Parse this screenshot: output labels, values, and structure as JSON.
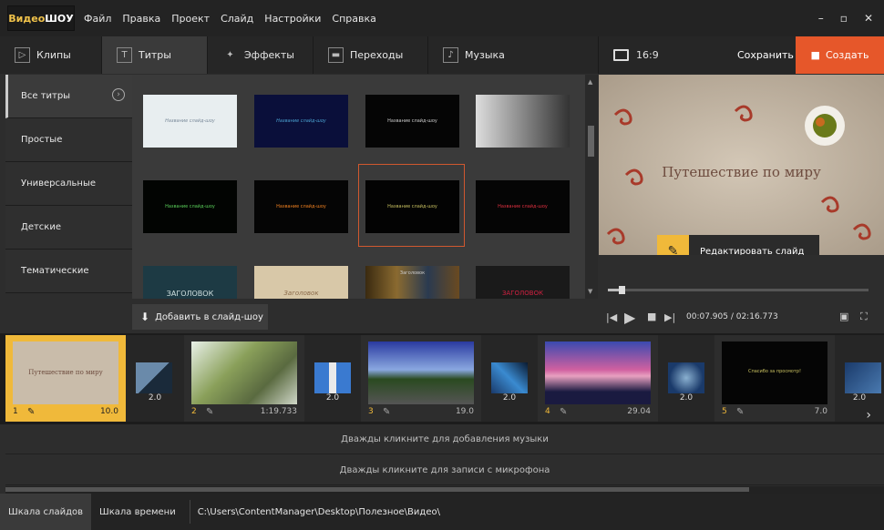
{
  "titlebar": {
    "logo_a": "Видео",
    "logo_b": "ШОУ",
    "menu": [
      "Файл",
      "Правка",
      "Проект",
      "Слайд",
      "Настройки",
      "Справка"
    ],
    "minimize": "–",
    "maximize": "▫",
    "close": "✕"
  },
  "tabs": [
    {
      "label": "Клипы",
      "icon": "clips-icon"
    },
    {
      "label": "Титры",
      "icon": "titles-icon"
    },
    {
      "label": "Эффекты",
      "icon": "effects-icon"
    },
    {
      "label": "Переходы",
      "icon": "transitions-icon"
    },
    {
      "label": "Музыка",
      "icon": "music-icon"
    }
  ],
  "header": {
    "ratio": "16:9",
    "save_label": "Сохранить",
    "create_label": "Создать"
  },
  "sidebar": {
    "items": [
      {
        "label": "Все титры"
      },
      {
        "label": "Простые"
      },
      {
        "label": "Универсальные"
      },
      {
        "label": "Детские"
      },
      {
        "label": "Тематические"
      }
    ]
  },
  "gallery": {
    "thumbs": [
      {
        "text": "Название слайд-шоу"
      },
      {
        "text": "Название слайд-шоу"
      },
      {
        "text": "Название слайд-шоу"
      },
      {
        "text": ""
      },
      {
        "text": "Название слайд-шоу"
      },
      {
        "text": "Название слайд-шоу"
      },
      {
        "text": "Название слайд-шоу"
      },
      {
        "text": "Название слайд-шоу"
      },
      {
        "text": "ЗАГОЛОВОК"
      },
      {
        "text": "Заголовок"
      },
      {
        "text": "Заголовок"
      },
      {
        "text": "ЗАГОЛОВОК"
      }
    ],
    "add_label": "Добавить в слайд-шоу"
  },
  "preview": {
    "title": "Путешествие по миру",
    "edit_label": "Редактировать слайд",
    "time": "00:07.905 / 02:16.773"
  },
  "timeline": {
    "slides": [
      {
        "num": "1",
        "dur": "10.0",
        "caption": "Путешествие по миру"
      },
      {
        "num": "2",
        "dur": "1:19.733"
      },
      {
        "num": "3",
        "dur": "19.0"
      },
      {
        "num": "4",
        "dur": "29.04"
      },
      {
        "num": "5",
        "dur": "7.0",
        "caption": "Спасибо за просмотр!"
      }
    ],
    "transitions": [
      "2.0",
      "2.0",
      "2.0",
      "2.0",
      "2.0"
    ]
  },
  "tracks": {
    "music": "Дважды кликните для добавления музыки",
    "mic": "Дважды кликните для записи с микрофона"
  },
  "status": {
    "tab1": "Шкала слайдов",
    "tab2": "Шкала времени",
    "path": "C:\\Users\\ContentManager\\Desktop\\Полезное\\Видео\\"
  }
}
